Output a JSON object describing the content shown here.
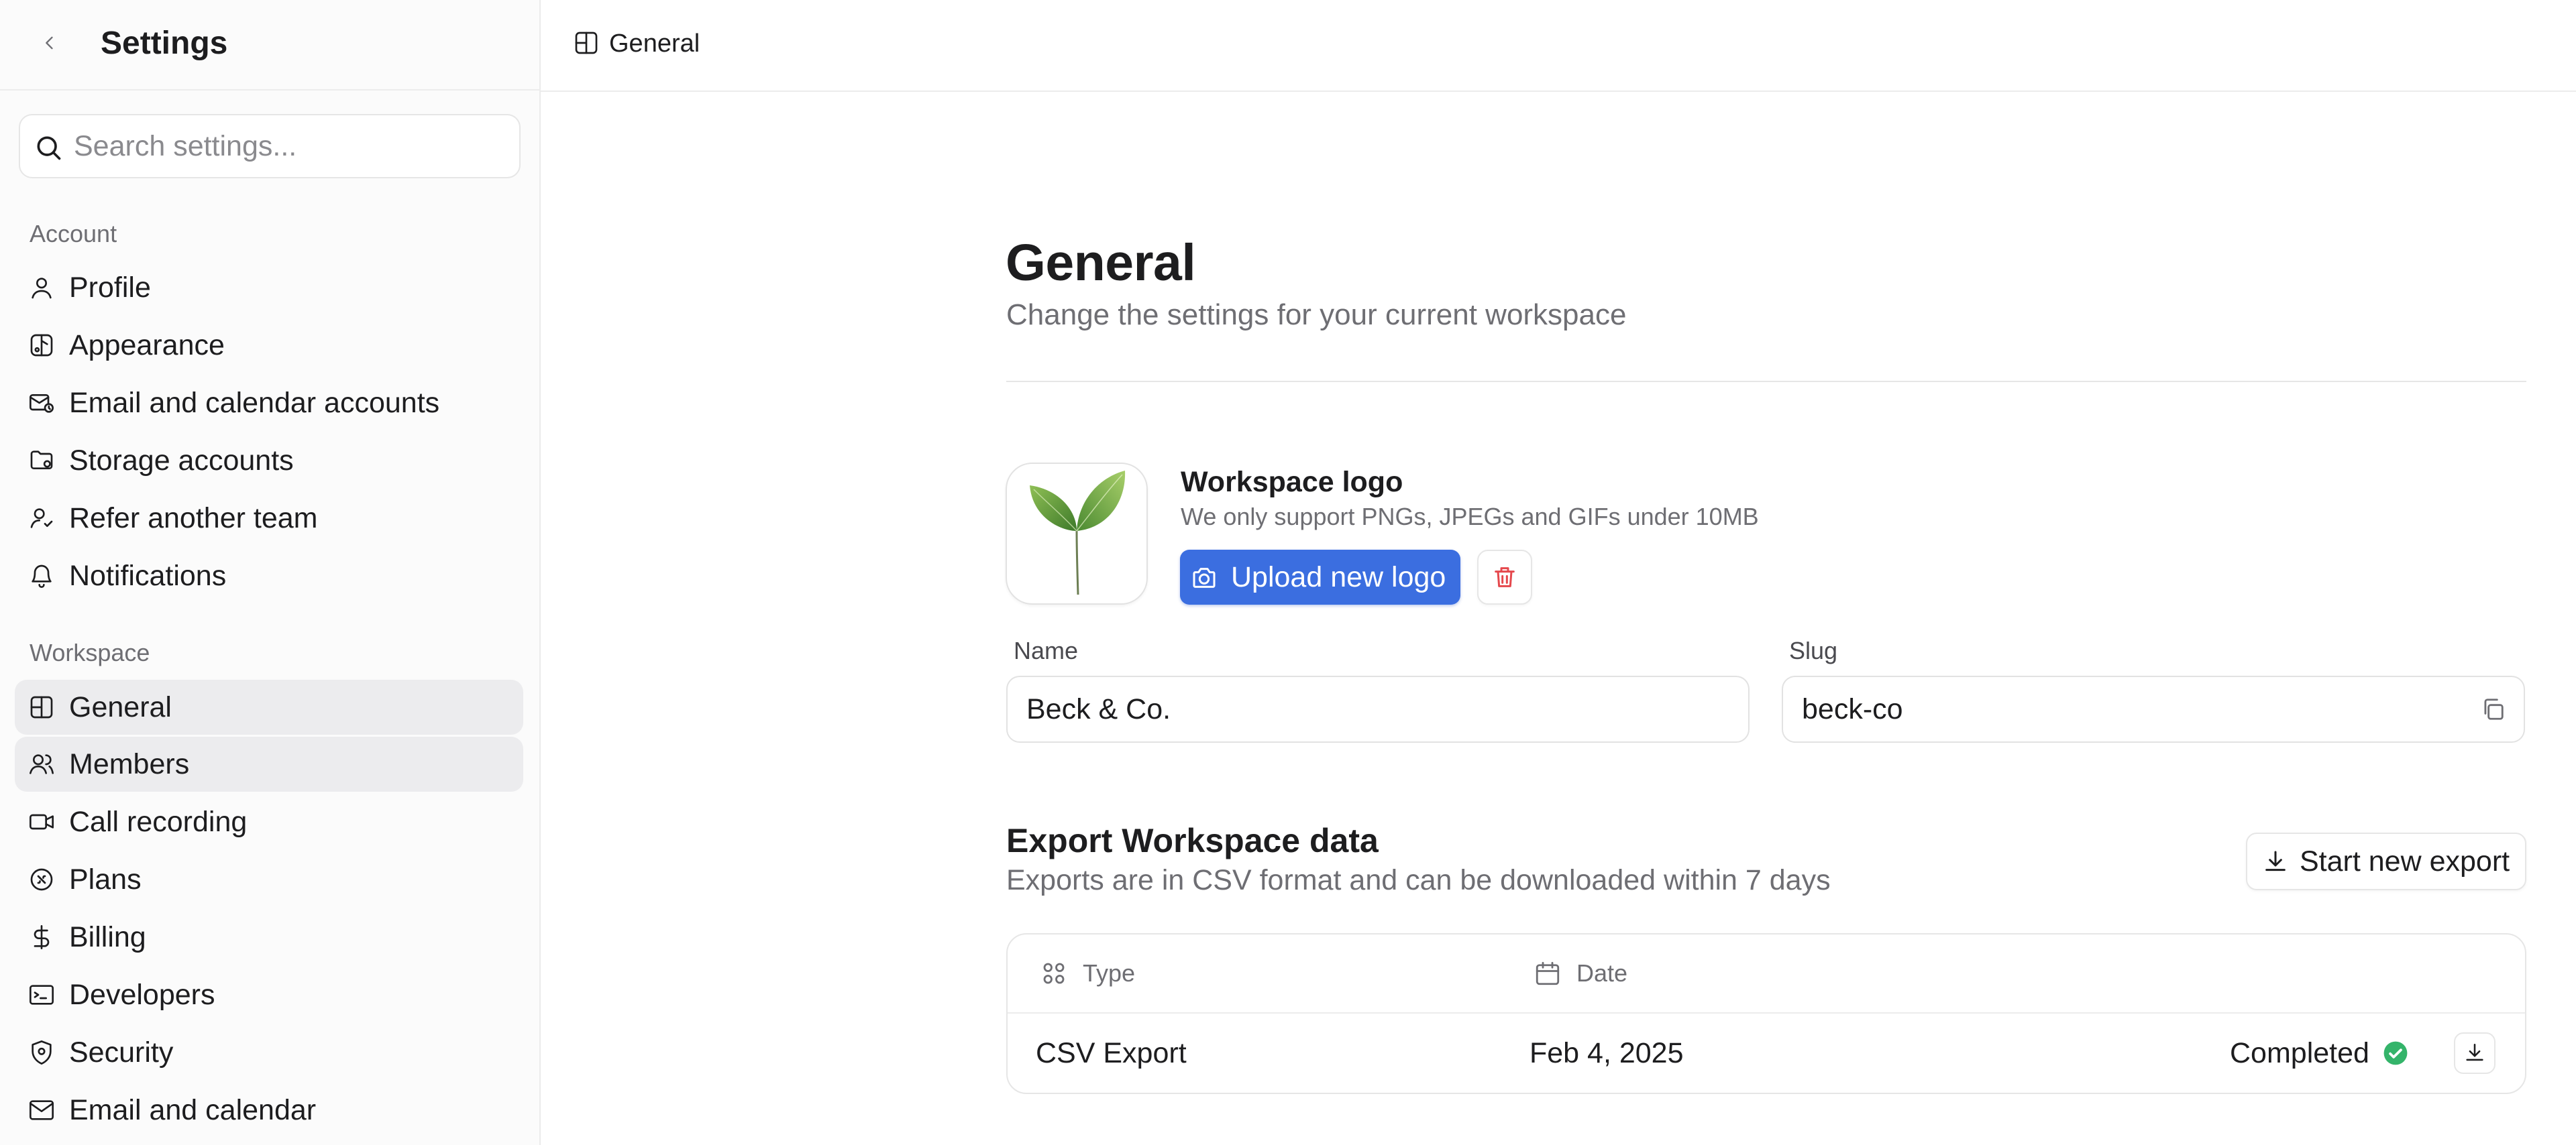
{
  "sidebar": {
    "title": "Settings",
    "search": {
      "placeholder": "Search settings...",
      "value": ""
    },
    "sections": [
      {
        "label": "Account",
        "items": [
          {
            "label": "Profile",
            "icon": "user-icon"
          },
          {
            "label": "Appearance",
            "icon": "palette-icon"
          },
          {
            "label": "Email and calendar accounts",
            "icon": "mail-calendar-icon"
          },
          {
            "label": "Storage accounts",
            "icon": "folder-icon"
          },
          {
            "label": "Refer another team",
            "icon": "user-plus-icon"
          },
          {
            "label": "Notifications",
            "icon": "bell-icon"
          }
        ]
      },
      {
        "label": "Workspace",
        "items": [
          {
            "label": "General",
            "icon": "layout-icon",
            "state": "active"
          },
          {
            "label": "Members",
            "icon": "users-icon",
            "state": "hover"
          },
          {
            "label": "Call recording",
            "icon": "video-icon"
          },
          {
            "label": "Plans",
            "icon": "badge-icon"
          },
          {
            "label": "Billing",
            "icon": "dollar-icon"
          },
          {
            "label": "Developers",
            "icon": "terminal-icon"
          },
          {
            "label": "Security",
            "icon": "shield-icon"
          },
          {
            "label": "Email and calendar",
            "icon": "mail-icon"
          }
        ]
      }
    ]
  },
  "topbar": {
    "breadcrumb": "General",
    "icon": "layout-icon"
  },
  "main": {
    "title": "General",
    "subtitle": "Change the settings for your current workspace",
    "logo": {
      "title": "Workspace logo",
      "help": "We only support PNGs, JPEGs and GIFs under 10MB",
      "upload_label": "Upload new logo",
      "upload_icon": "camera-icon",
      "delete_icon": "trash-icon"
    },
    "name_field": {
      "label": "Name",
      "value": "Beck & Co."
    },
    "slug_field": {
      "label": "Slug",
      "value": "beck-co",
      "copy_icon": "copy-icon"
    },
    "export": {
      "title": "Export Workspace data",
      "subtitle": "Exports are in CSV format and can be downloaded within 7 days",
      "button_label": "Start new export",
      "button_icon": "download-icon",
      "table": {
        "columns": [
          {
            "label": "Type",
            "icon": "grid-icon"
          },
          {
            "label": "Date",
            "icon": "calendar-icon"
          }
        ],
        "rows": [
          {
            "type": "CSV Export",
            "date": "Feb 4, 2025",
            "status": "Completed",
            "status_icon": "check-circle-icon"
          }
        ]
      }
    }
  },
  "colors": {
    "accent": "#3b6ee0",
    "active_nav": "#ececee",
    "success": "#34b46a",
    "danger": "#e5484d",
    "muted_text": "#6e6e73"
  }
}
